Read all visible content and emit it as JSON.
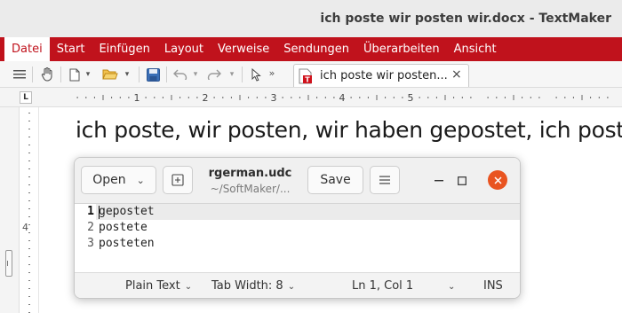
{
  "window": {
    "title": "ich poste wir posten wir.docx - TextMaker"
  },
  "menubar": {
    "items": [
      "Datei",
      "Start",
      "Einfügen",
      "Layout",
      "Verweise",
      "Sendungen",
      "Überarbeiten",
      "Ansicht"
    ],
    "active_index": 0
  },
  "toolbar": {
    "icons": [
      "menu-icon",
      "hand-icon",
      "new-document-icon",
      "open-folder-icon",
      "save-icon",
      "undo-icon",
      "redo-icon",
      "pointer-icon"
    ],
    "document_tab": {
      "label": "ich poste wir posten...",
      "close": "×"
    }
  },
  "ruler": {
    "tab_stop_symbol": "L",
    "numbers": [
      "1",
      "2",
      "3",
      "4",
      "5"
    ],
    "vertical_number": "4"
  },
  "document": {
    "text": "ich poste, wir posten, wir haben gepostet, ich poste"
  },
  "editor_dialog": {
    "open_label": "Open",
    "filename": "rgerman.udc",
    "path": "~/SoftMaker/...",
    "save_label": "Save",
    "lines": [
      {
        "number": "1",
        "text": "gepostet"
      },
      {
        "number": "2",
        "text": "postete"
      },
      {
        "number": "3",
        "text": "posteten"
      }
    ],
    "status": {
      "language": "Plain Text",
      "tab_width": "Tab Width: 8",
      "position": "Ln 1, Col 1",
      "mode": "INS"
    }
  },
  "colors": {
    "menubar_bg": "#c0121c",
    "close_button": "#e95420"
  }
}
